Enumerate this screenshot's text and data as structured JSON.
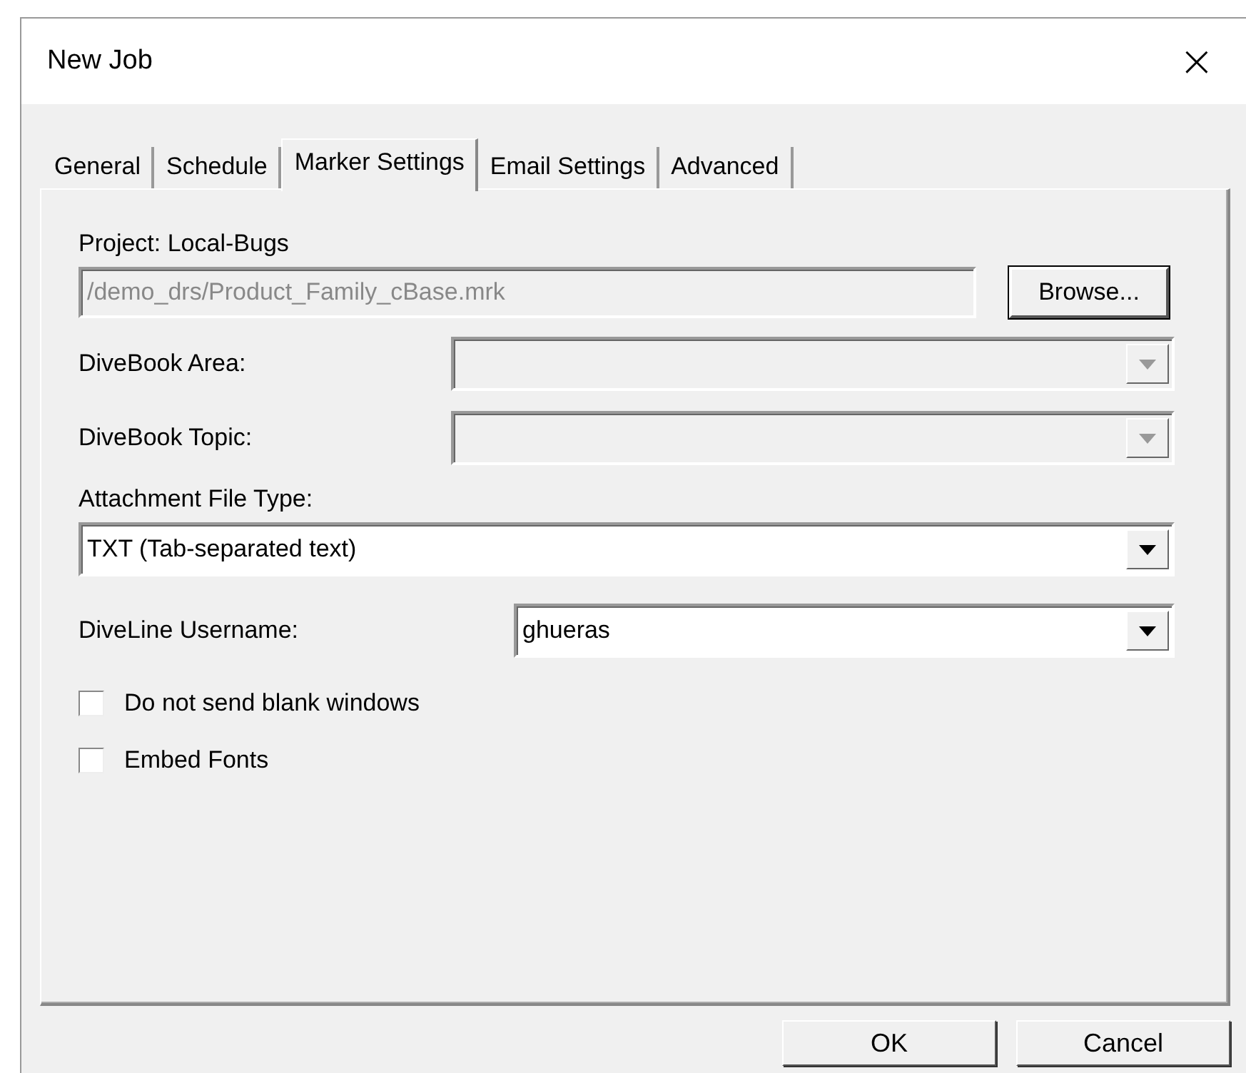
{
  "window": {
    "title": "New Job",
    "close": "×"
  },
  "tabs": [
    {
      "label": "General",
      "selected": false
    },
    {
      "label": "Schedule",
      "selected": false
    },
    {
      "label": "Marker Settings",
      "selected": true
    },
    {
      "label": "Email Settings",
      "selected": false
    },
    {
      "label": "Advanced",
      "selected": false
    }
  ],
  "project": {
    "label": "Project: Local-Bugs",
    "path": "/demo_drs/Product_Family_cBase.mrk",
    "disabled": true,
    "browse": "Browse..."
  },
  "rows": [
    {
      "label": "DiveBook Area:",
      "disabled": true
    },
    {
      "label": "DiveBook Topic:",
      "disabled": true
    }
  ],
  "attachment": {
    "label": "Attachment File Type:",
    "value": "TXT (Tab-separated text)",
    "disabled": false
  },
  "username": {
    "label": "DiveLine Username:",
    "value": "ghueras",
    "disabled": false
  },
  "checkboxes": [
    {
      "label": "Do not send blank windows",
      "checked": false
    },
    {
      "label": "Embed Fonts",
      "checked": false
    }
  ],
  "buttons": [
    "OK",
    "Cancel"
  ]
}
